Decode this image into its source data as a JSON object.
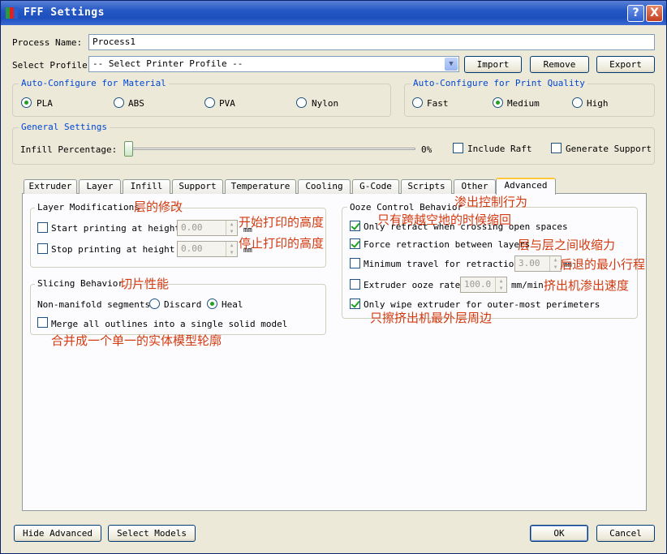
{
  "window": {
    "title": "FFF Settings",
    "help": "?",
    "close": "X"
  },
  "process_name": {
    "label": "Process Name:",
    "value": "Process1"
  },
  "profile": {
    "label": "Select Profile:",
    "value": "-- Select Printer Profile --",
    "import": "Import",
    "remove": "Remove",
    "export": "Export"
  },
  "material": {
    "title": "Auto-Configure for Material",
    "options": [
      "PLA",
      "ABS",
      "PVA",
      "Nylon"
    ],
    "selected": "PLA"
  },
  "quality": {
    "title": "Auto-Configure for Print Quality",
    "options": [
      "Fast",
      "Medium",
      "High"
    ],
    "selected": "Medium"
  },
  "general": {
    "title": "General Settings",
    "infill_label": "Infill Percentage:",
    "infill_value": "0%",
    "infill_fraction": 0,
    "include_raft": "Include Raft",
    "generate_support": "Generate Support"
  },
  "tabs": [
    "Extruder",
    "Layer",
    "Infill",
    "Support",
    "Temperature",
    "Cooling",
    "G-Code",
    "Scripts",
    "Other",
    "Advanced"
  ],
  "active_tab": "Advanced",
  "layer_mod": {
    "title": "Layer Modifications",
    "title_zh": "层的修改",
    "start_label": "Start printing at height",
    "start_value": "0.00",
    "start_unit": "mm",
    "start_zh": "开始打印的高度",
    "stop_label": "Stop printing at height",
    "stop_value": "0.00",
    "stop_unit": "mm",
    "stop_zh": "停止打印的高度"
  },
  "slicing": {
    "title": "Slicing Behavior",
    "title_zh": "切片性能",
    "segments_label": "Non-manifold segments:",
    "discard": "Discard",
    "heal": "Heal",
    "selected": "Heal",
    "merge_label": "Merge all outlines into a single solid model",
    "merge_zh": "合并成一个单一的实体模型轮廓"
  },
  "ooze": {
    "title": "Ooze Control Behavior",
    "title_zh": "渗出控制行为",
    "only_retract": "Only retract when crossing open spaces",
    "only_retract_zh": "只有跨越空地的时候缩回",
    "force_retract": "Force retraction between layers",
    "force_retract_zh": "层与层之间收缩力",
    "min_travel": "Minimum travel for retraction",
    "min_travel_value": "3.00",
    "min_travel_unit": "mm",
    "min_travel_zh": "后退的最小行程",
    "ooze_rate": "Extruder ooze rate",
    "ooze_rate_value": "100.0",
    "ooze_rate_unit": "mm/min",
    "ooze_rate_zh": "挤出机渗出速度",
    "only_wipe": "Only wipe extruder for outer-most perimeters",
    "only_wipe_zh": "只擦挤出机最外层周边"
  },
  "footer": {
    "hide_advanced": "Hide Advanced",
    "select_models": "Select Models",
    "ok": "OK",
    "cancel": "Cancel"
  },
  "colors": {
    "accent": "#0046d5",
    "annotation": "#d23a10",
    "titlebar": "#2457c4"
  }
}
